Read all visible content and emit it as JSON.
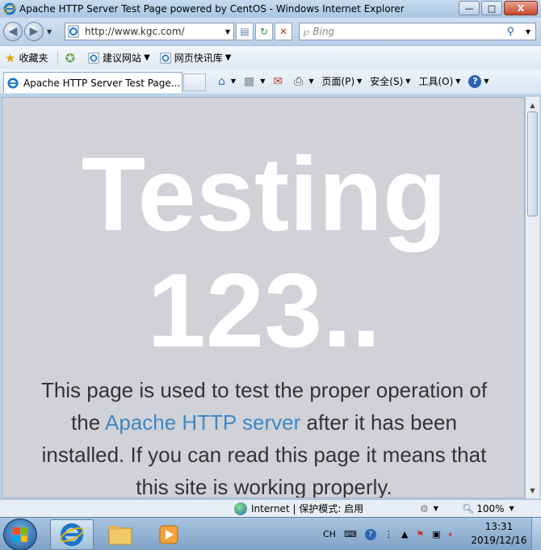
{
  "window": {
    "title": "Apache HTTP Server Test Page powered by CentOS - Windows Internet Explorer",
    "minimize": "—",
    "maximize": "□",
    "close": "X"
  },
  "address_bar": {
    "url": "http://www.kgc.com/",
    "search_placeholder": "Bing"
  },
  "favorites_bar": {
    "favorites_label": "收藏夹",
    "items": [
      "建议网站",
      "网页快讯库"
    ]
  },
  "tab": {
    "label": "Apache HTTP Server Test Page..."
  },
  "command_bar": {
    "page": "页面(P)",
    "safety": "安全(S)",
    "tools": "工具(O)",
    "help": "?"
  },
  "content": {
    "heading_line1": "Testing",
    "heading_line2": "123..",
    "paragraph_before_link": "This page is used to test the proper operation of the ",
    "link_text": "Apache HTTP server",
    "paragraph_after_link": " after it has been installed. If you can read this page it means that this site is working properly."
  },
  "status_bar": {
    "zone": "Internet | 保护模式: 启用",
    "zoom": "100%"
  },
  "taskbar": {
    "lang": "CH",
    "time": "13:31",
    "date": "2019/12/16"
  },
  "colors": {
    "page_background": "#d0d2d8",
    "link": "#3f88c5",
    "heading": "#ffffff"
  }
}
